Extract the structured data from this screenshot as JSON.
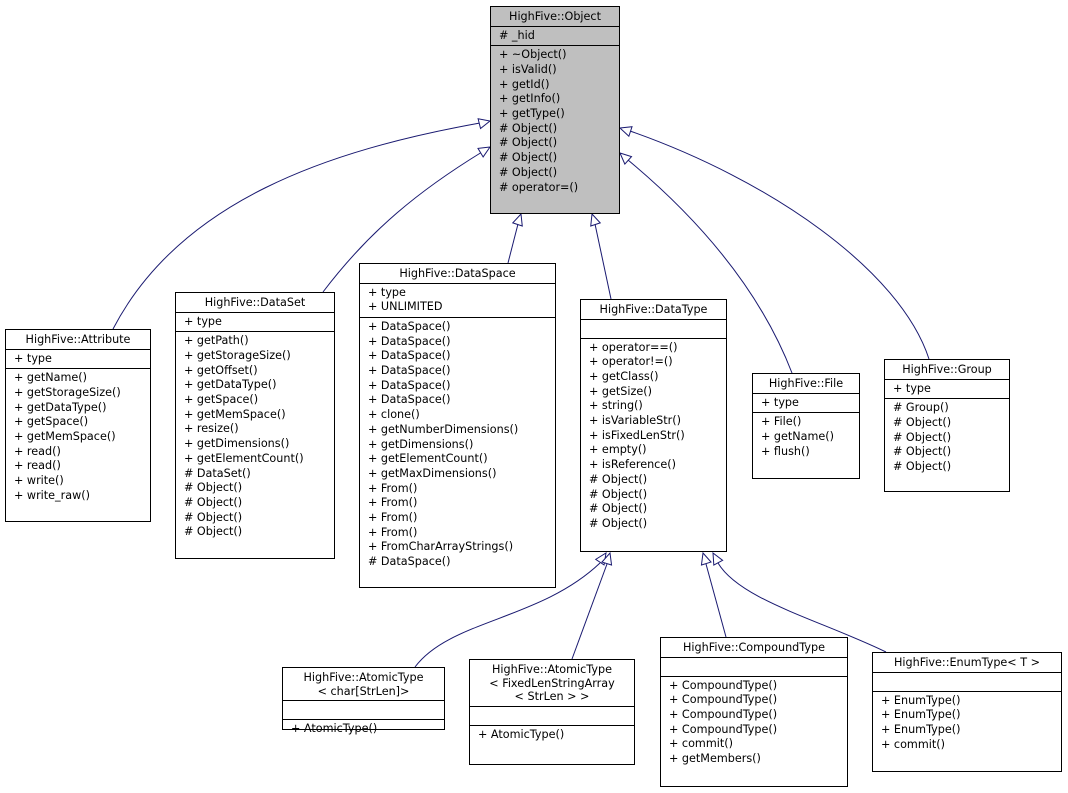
{
  "diagram": {
    "type": "class-inheritance",
    "edge_color": "#191970",
    "root_fill": "#bfbfbf",
    "classes": [
      {
        "id": "object",
        "title": [
          "HighFive::Object"
        ],
        "attributes": [
          "# _hid"
        ],
        "methods": [
          "+ ~Object()",
          "+ isValid()",
          "+ getId()",
          "+ getInfo()",
          "+ getType()",
          "# Object()",
          "# Object()",
          "# Object()",
          "# Object()",
          "# operator=()"
        ]
      },
      {
        "id": "attribute",
        "title": [
          "HighFive::Attribute"
        ],
        "attributes": [
          "+ type"
        ],
        "methods": [
          "+ getName()",
          "+ getStorageSize()",
          "+ getDataType()",
          "+ getSpace()",
          "+ getMemSpace()",
          "+ read()",
          "+ read()",
          "+ write()",
          "+ write_raw()"
        ]
      },
      {
        "id": "dataset",
        "title": [
          "HighFive::DataSet"
        ],
        "attributes": [
          "+ type"
        ],
        "methods": [
          "+ getPath()",
          "+ getStorageSize()",
          "+ getOffset()",
          "+ getDataType()",
          "+ getSpace()",
          "+ getMemSpace()",
          "+ resize()",
          "+ getDimensions()",
          "+ getElementCount()",
          "# DataSet()",
          "# Object()",
          "# Object()",
          "# Object()",
          "# Object()"
        ]
      },
      {
        "id": "dataspace",
        "title": [
          "HighFive::DataSpace"
        ],
        "attributes": [
          "+ type",
          "+ UNLIMITED"
        ],
        "methods": [
          "+ DataSpace()",
          "+ DataSpace()",
          "+ DataSpace()",
          "+ DataSpace()",
          "+ DataSpace()",
          "+ DataSpace()",
          "+ clone()",
          "+ getNumberDimensions()",
          "+ getDimensions()",
          "+ getElementCount()",
          "+ getMaxDimensions()",
          "+ From()",
          "+ From()",
          "+ From()",
          "+ From()",
          "+ FromCharArrayStrings()",
          "# DataSpace()"
        ]
      },
      {
        "id": "datatype",
        "title": [
          "HighFive::DataType"
        ],
        "attributes": [],
        "methods": [
          "+ operator==()",
          "+ operator!=()",
          "+ getClass()",
          "+ getSize()",
          "+ string()",
          "+ isVariableStr()",
          "+ isFixedLenStr()",
          "+ empty()",
          "+ isReference()",
          "# Object()",
          "# Object()",
          "# Object()",
          "# Object()"
        ]
      },
      {
        "id": "file",
        "title": [
          "HighFive::File"
        ],
        "attributes": [
          "+ type"
        ],
        "methods": [
          "+ File()",
          "+ getName()",
          "+ flush()"
        ]
      },
      {
        "id": "group",
        "title": [
          "HighFive::Group"
        ],
        "attributes": [
          "+ type"
        ],
        "methods": [
          "# Group()",
          "# Object()",
          "# Object()",
          "# Object()",
          "# Object()"
        ]
      },
      {
        "id": "atomic_char",
        "title": [
          "HighFive::AtomicType",
          "< char[StrLen]>"
        ],
        "attributes": [],
        "methods": [
          "+ AtomicType()"
        ]
      },
      {
        "id": "atomic_fixed",
        "title": [
          "HighFive::AtomicType",
          "< FixedLenStringArray",
          "< StrLen > >"
        ],
        "attributes": [],
        "methods": [
          "+ AtomicType()"
        ]
      },
      {
        "id": "compound",
        "title": [
          "HighFive::CompoundType"
        ],
        "attributes": [],
        "methods": [
          "+ CompoundType()",
          "+ CompoundType()",
          "+ CompoundType()",
          "+ CompoundType()",
          "+ commit()",
          "+ getMembers()"
        ]
      },
      {
        "id": "enumtype",
        "title": [
          "HighFive::EnumType< T >"
        ],
        "attributes": [],
        "methods": [
          "+ EnumType()",
          "+ EnumType()",
          "+ EnumType()",
          "+ commit()"
        ]
      }
    ],
    "inheritance": [
      {
        "child": "attribute",
        "parent": "object"
      },
      {
        "child": "dataset",
        "parent": "object"
      },
      {
        "child": "dataspace",
        "parent": "object"
      },
      {
        "child": "datatype",
        "parent": "object"
      },
      {
        "child": "file",
        "parent": "object"
      },
      {
        "child": "group",
        "parent": "object"
      },
      {
        "child": "atomic_char",
        "parent": "datatype"
      },
      {
        "child": "atomic_fixed",
        "parent": "datatype"
      },
      {
        "child": "compound",
        "parent": "datatype"
      },
      {
        "child": "enumtype",
        "parent": "datatype"
      }
    ]
  }
}
